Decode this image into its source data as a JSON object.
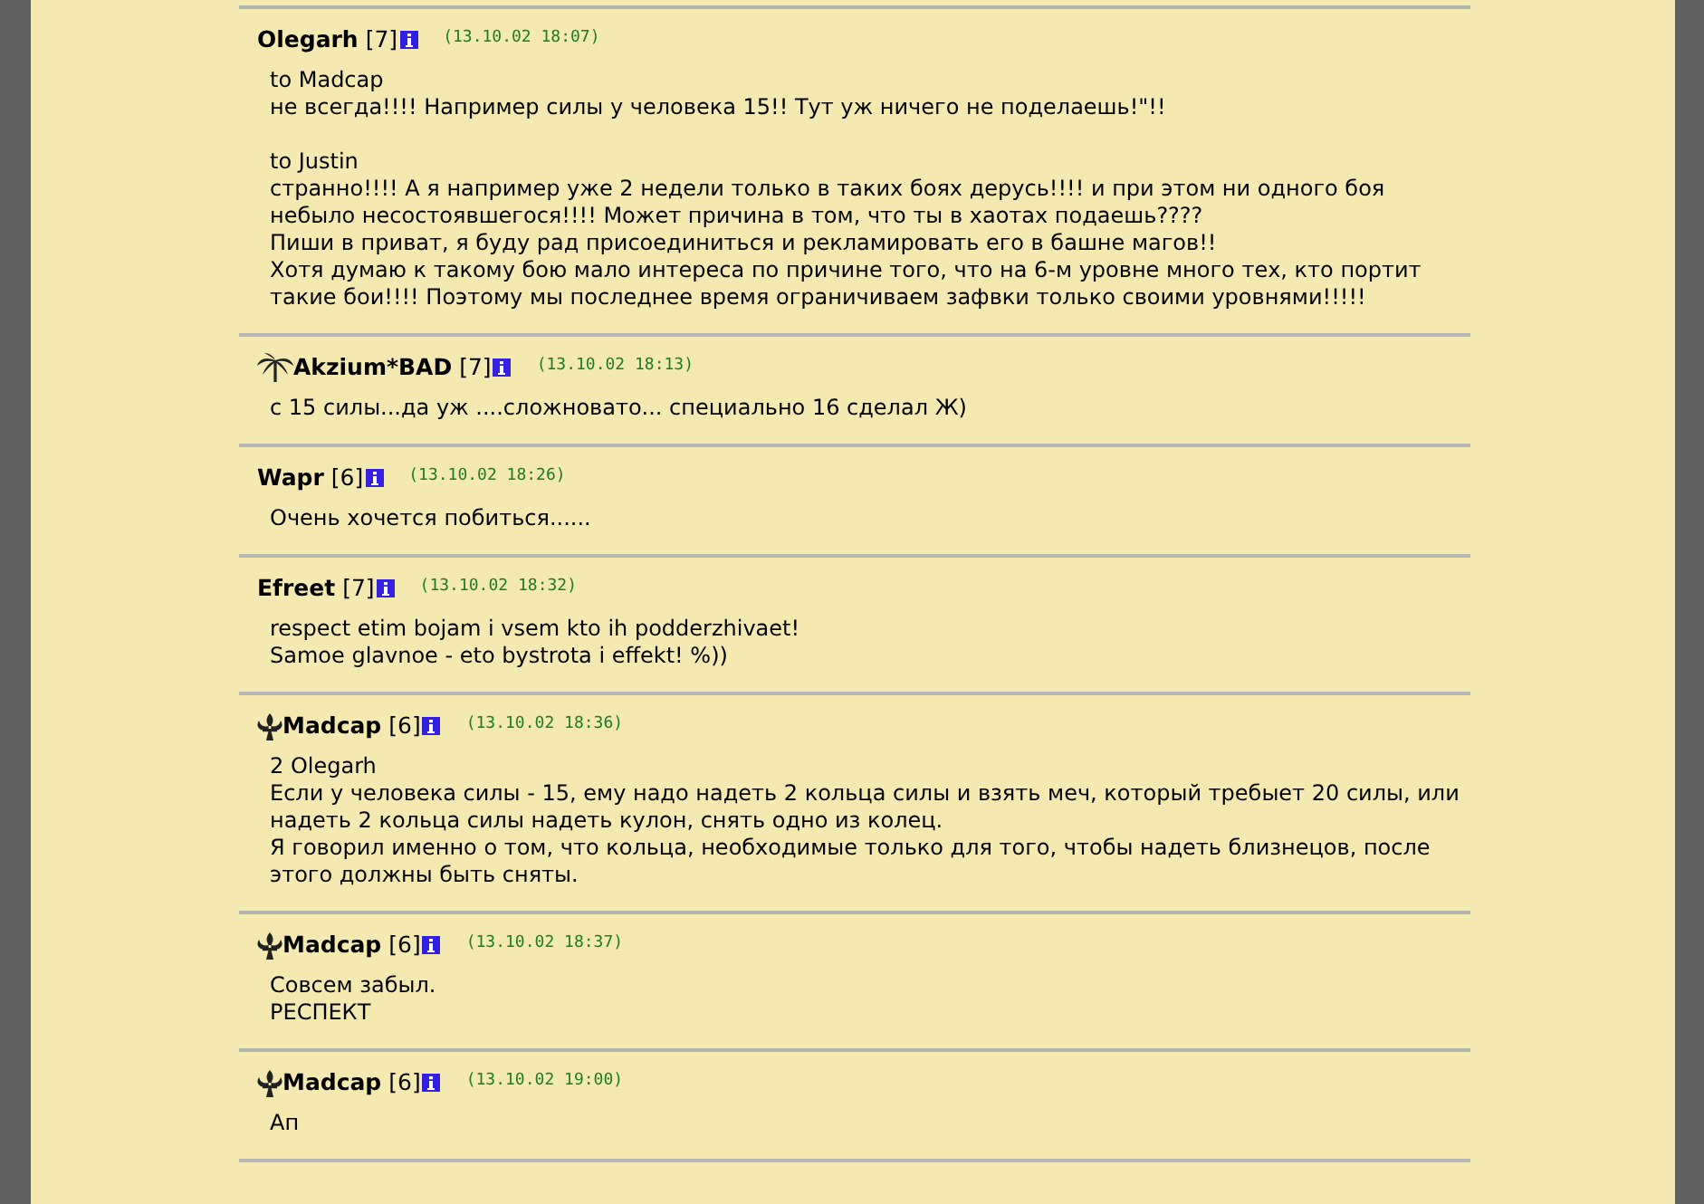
{
  "posts": [
    {
      "author": "Olegarh",
      "level": "[7]",
      "time": "(13.10.02 18:07)",
      "kind": "plain",
      "paragraphs": [
        [
          "to Madcap",
          "не всегда!!!! Например силы у человека 15!! Тут уж ничего не поделаешь!\"!!"
        ],
        [
          "to Justin",
          "странно!!!! А я например уже 2 недели только в таких боях дерусь!!!! и при этом ни одного боя небыло несостоявшегося!!!! Может причина в том, что ты в хаотах подаешь????",
          "Пиши в приват, я буду рад присоединиться и рекламировать его в башне магов!!",
          "Хотя думаю к такому бою мало интереса по причине того, что на 6-м уровне много тех, кто портит такие бои!!!! Поэтому мы последнее время ограничиваем зафвки только своими уровнями!!!!!"
        ]
      ]
    },
    {
      "author": "Akzium*BAD",
      "level": "[7]",
      "time": "(13.10.02 18:13)",
      "kind": "palm",
      "paragraphs": [
        [
          "с 15 силы...да уж ....сложновато... специально 16 сделал Ж)"
        ]
      ]
    },
    {
      "author": "Wapr",
      "level": "[6]",
      "time": "(13.10.02 18:26)",
      "kind": "plain",
      "paragraphs": [
        [
          "Очень хочется побиться......"
        ]
      ]
    },
    {
      "author": "Efreet",
      "level": "[7]",
      "time": "(13.10.02 18:32)",
      "kind": "plain",
      "paragraphs": [
        [
          "respect etim bojam i vsem kto ih podderzhivaet!",
          "Samoe glavnoe - eto bystrota i effekt! %))"
        ]
      ]
    },
    {
      "author": "Madcap",
      "level": "[6]",
      "time": "(13.10.02 18:36)",
      "kind": "fleur",
      "paragraphs": [
        [
          "2 Olegarh",
          "Если у человека силы - 15, ему надо надеть 2 кольца силы  и взять меч, который требыет 20 силы, или надеть 2 кольца силы надеть кулон, снять одно из колец.",
          "Я говорил именно о том, что кольца, необходимые только для того, чтобы надеть близнецов, после этого должны быть сняты."
        ]
      ]
    },
    {
      "author": "Madcap",
      "level": "[6]",
      "time": "(13.10.02 18:37)",
      "kind": "fleur",
      "paragraphs": [
        [
          "Совсем забыл.",
          "РЕСПЕКТ"
        ]
      ]
    },
    {
      "author": "Madcap",
      "level": "[6]",
      "time": "(13.10.02 19:00)",
      "kind": "fleur",
      "paragraphs": [
        [
          "Ап"
        ]
      ]
    }
  ]
}
